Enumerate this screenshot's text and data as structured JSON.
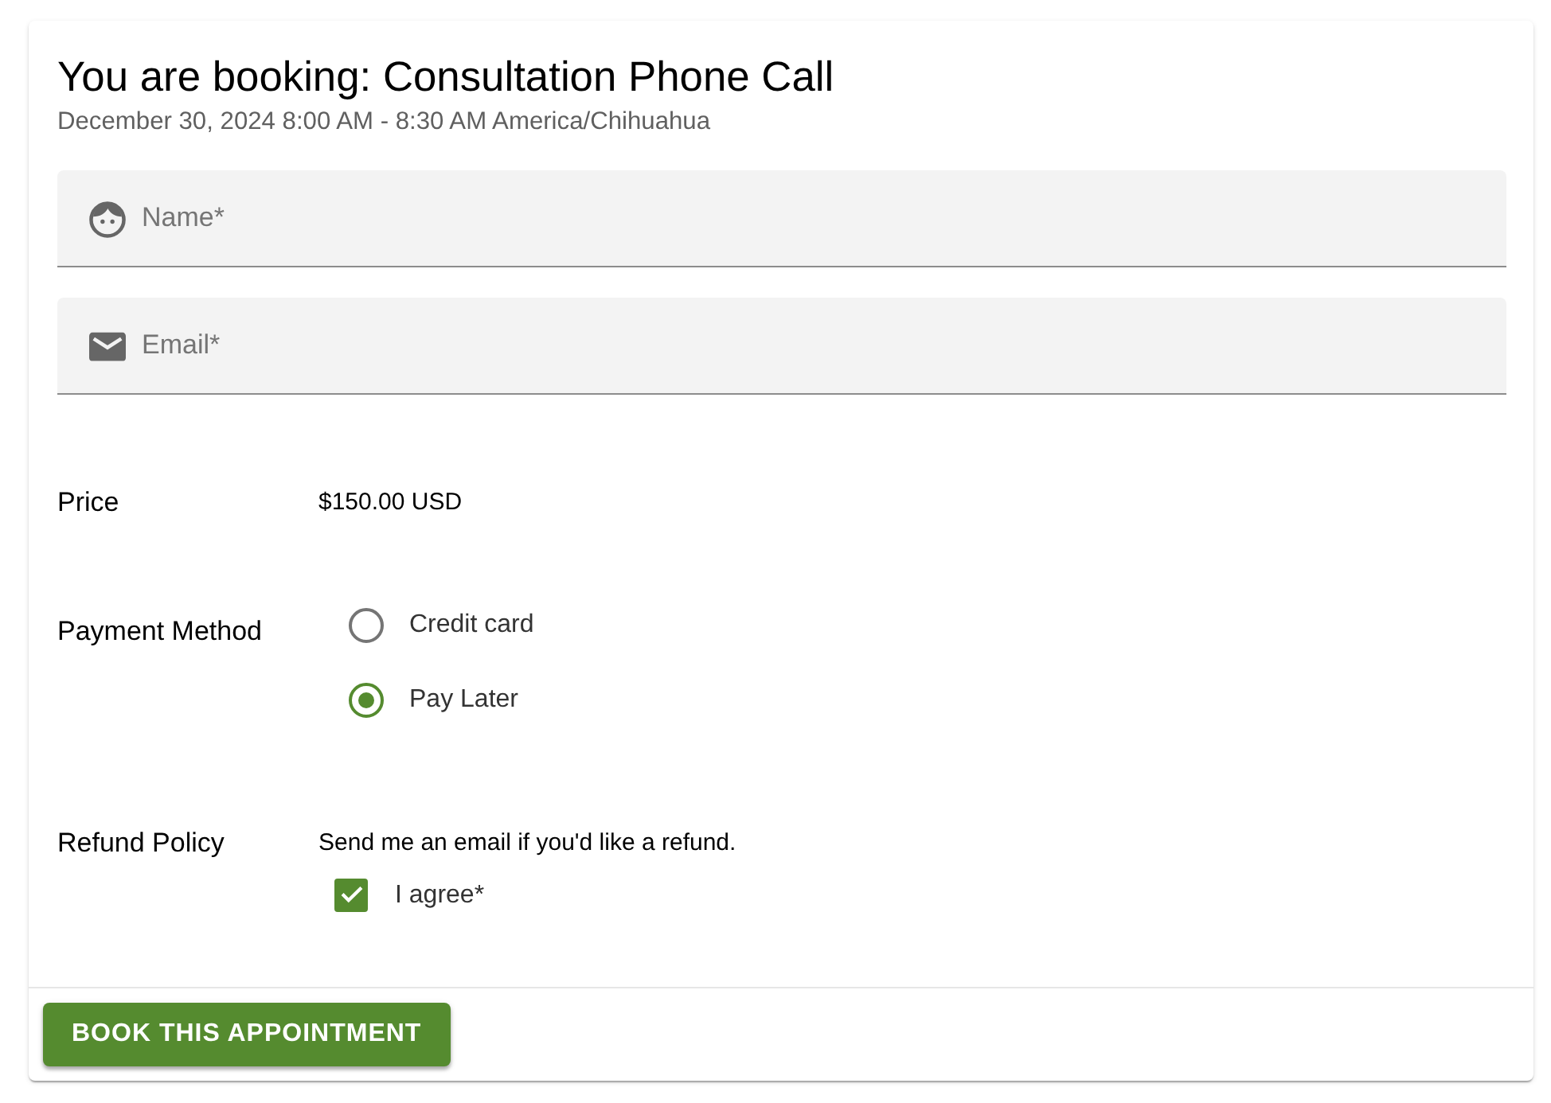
{
  "booking": {
    "title": "You are booking: Consultation Phone Call",
    "subtitle": "December 30, 2024 8:00 AM - 8:30 AM America/Chihuahua"
  },
  "fields": [
    {
      "kind": "name",
      "placeholder": "Name*"
    },
    {
      "kind": "email",
      "placeholder": "Email*"
    }
  ],
  "price": {
    "label": "Price",
    "value": "$150.00 USD"
  },
  "payment_method": {
    "label": "Payment Method",
    "options": [
      {
        "label": "Credit card",
        "selected": false
      },
      {
        "label": "Pay Later",
        "selected": true
      }
    ]
  },
  "refund_policy": {
    "label": "Refund Policy",
    "text": "Send me an email if you'd like a refund.",
    "agree": {
      "label": "I agree*",
      "checked": true
    }
  },
  "submit_button": {
    "label": "BOOK THIS APPOINTMENT"
  }
}
